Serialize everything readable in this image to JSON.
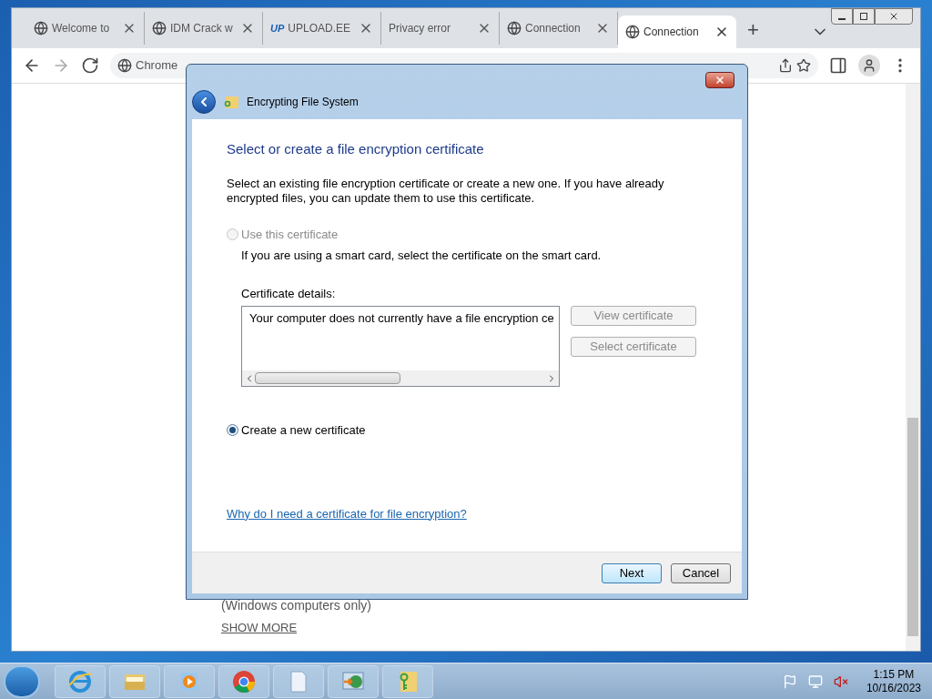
{
  "browser": {
    "tabs": [
      {
        "label": "Welcome to",
        "kind": "globe",
        "selected": false
      },
      {
        "label": "IDM Crack w",
        "kind": "globe",
        "selected": false
      },
      {
        "label": "UPLOAD.EE",
        "kind": "logo",
        "logo_text": "UP",
        "selected": false
      },
      {
        "label": "Privacy error",
        "kind": "plain",
        "selected": false
      },
      {
        "label": "Connection",
        "kind": "globe",
        "selected": false
      },
      {
        "label": "Connection",
        "kind": "globe",
        "selected": true
      }
    ],
    "new_tab": "+",
    "address": "Chrome",
    "page": {
      "note": "(Windows computers only)",
      "link": "SHOW MORE"
    }
  },
  "dialog": {
    "title": "Encrypting File System",
    "heading": "Select or create a file encryption certificate",
    "intro": "Select an existing file encryption certificate or create a new one. If you have already encrypted files, you can update them to use this certificate.",
    "options": [
      {
        "label": "Use this certificate",
        "selected": false,
        "disabled": true,
        "hint": "If you are using a smart card, select the certificate on the smart card."
      },
      {
        "label": "Create a new certificate",
        "selected": true,
        "disabled": false
      }
    ],
    "details_label": "Certificate details:",
    "details_text": "Your computer does not currently have a file encryption ce",
    "side_buttons": [
      {
        "label": "View certificate",
        "disabled": true
      },
      {
        "label": "Select certificate",
        "disabled": true
      }
    ],
    "help_link": "Why do I need a certificate for file encryption?",
    "buttons": [
      {
        "label": "Next",
        "default": true
      },
      {
        "label": "Cancel",
        "default": false
      }
    ]
  },
  "taskbar": {
    "apps": [
      {
        "kind": "ie"
      },
      {
        "kind": "folder"
      },
      {
        "kind": "media"
      },
      {
        "kind": "chrome"
      },
      {
        "kind": "document"
      },
      {
        "kind": "network"
      },
      {
        "kind": "keyfolder"
      }
    ],
    "time": "1:15 PM",
    "date": "10/16/2023"
  }
}
